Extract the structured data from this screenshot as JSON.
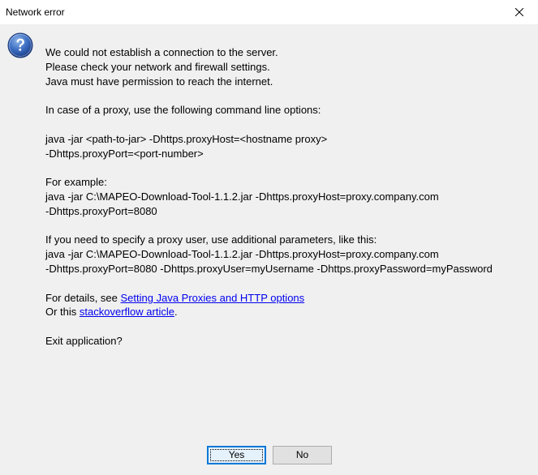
{
  "window": {
    "title": "Network error",
    "close_icon": "close-icon",
    "icon": "question-icon",
    "accent_color": "#0078d7",
    "link_color": "#0000ee"
  },
  "message": {
    "intro": [
      "We could not establish a connection to the server.",
      "Please check your network and firewall settings.",
      "Java must have permission to reach the internet."
    ],
    "proxy_intro": "In case of a proxy, use the following command line options:",
    "proxy_cmd": [
      "java -jar <path-to-jar> -Dhttps.proxyHost=<hostname proxy>",
      "-Dhttps.proxyPort=<port-number>"
    ],
    "example_label": "For example:",
    "example_cmd": [
      "java -jar C:\\MAPEO-Download-Tool-1.1.2.jar -Dhttps.proxyHost=proxy.company.com",
      "-Dhttps.proxyPort=8080"
    ],
    "user_intro": "If you need to specify a proxy user, use additional parameters, like this:",
    "user_cmd": [
      "java -jar C:\\MAPEO-Download-Tool-1.1.2.jar -Dhttps.proxyHost=proxy.company.com",
      "-Dhttps.proxyPort=8080 -Dhttps.proxyUser=myUsername -Dhttps.proxyPassword=myPassword"
    ],
    "details_prefix": "For details, see ",
    "details_link": "Setting Java Proxies and HTTP options",
    "or_prefix": "Or this ",
    "or_link": "stackoverflow article",
    "or_suffix": ".",
    "question": "Exit application?"
  },
  "buttons": {
    "yes": "Yes",
    "no": "No"
  }
}
